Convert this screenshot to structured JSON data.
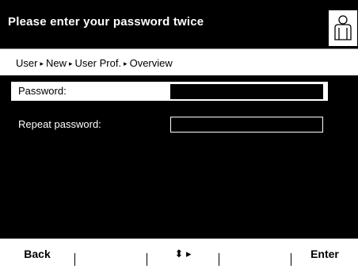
{
  "header": {
    "title": "Please enter your password twice",
    "icon": "user-icon"
  },
  "breadcrumb": {
    "items": [
      "User",
      "New",
      "User Prof.",
      "Overview"
    ],
    "separator": "▸"
  },
  "form": {
    "fields": [
      {
        "label": "Password:",
        "value": "",
        "selected": true
      },
      {
        "label": "Repeat password:",
        "value": "",
        "selected": false
      }
    ]
  },
  "softkeys": {
    "back": "Back",
    "key2": "",
    "nav": "⬍ ▸",
    "key4": "",
    "enter": "Enter"
  },
  "colors": {
    "background": "#000000",
    "foreground": "#ffffff"
  }
}
